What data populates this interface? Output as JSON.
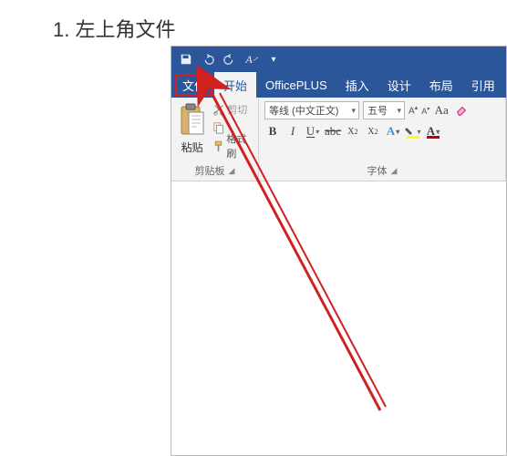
{
  "step": {
    "text": "1. 左上角文件"
  },
  "titlebar": {
    "icons": [
      "save",
      "undo",
      "redo",
      "style-clear",
      "dropdown"
    ]
  },
  "menubar": {
    "items": [
      {
        "label": "文件",
        "state": "highlighted"
      },
      {
        "label": "开始",
        "state": "active"
      },
      {
        "label": "OfficePLUS",
        "state": ""
      },
      {
        "label": "插入",
        "state": ""
      },
      {
        "label": "设计",
        "state": ""
      },
      {
        "label": "布局",
        "state": ""
      },
      {
        "label": "引用",
        "state": ""
      }
    ]
  },
  "ribbon": {
    "clipboard": {
      "paste": "粘贴",
      "cut": "剪切",
      "copy": "",
      "format_painter": "格式刷",
      "group_label": "剪贴板"
    },
    "font": {
      "font_name": "等线 (中文正文)",
      "font_size": "五号",
      "group_label": "字体",
      "aa_case": "Aa",
      "highlight_color": "#ffff00",
      "font_color": "#c00000"
    }
  }
}
